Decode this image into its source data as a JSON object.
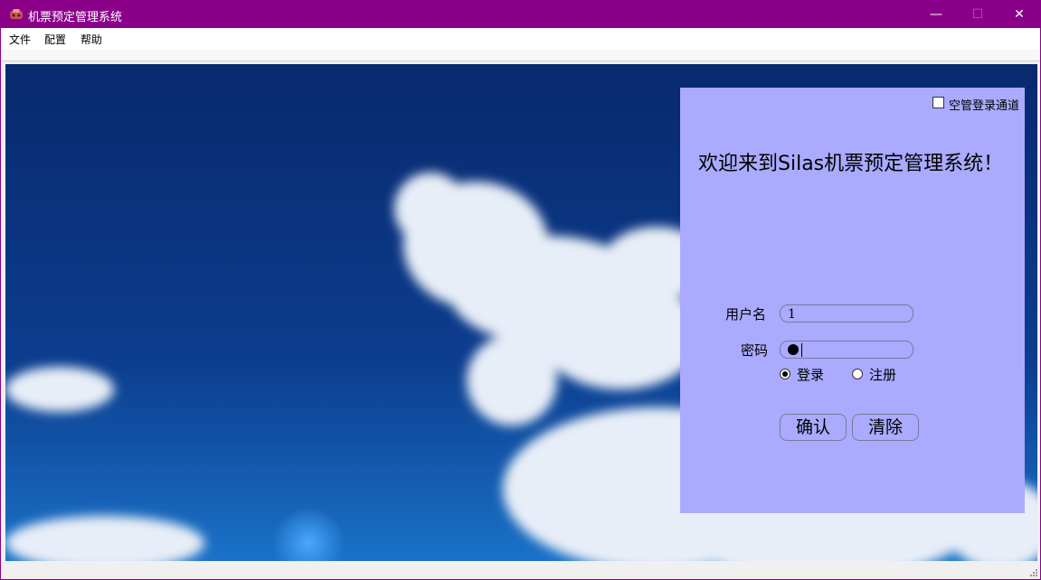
{
  "window": {
    "title": "机票预定管理系统",
    "accent": "#8b0089",
    "controls": {
      "minimize": "—",
      "maximize": "☐",
      "close": "✕"
    }
  },
  "menu": {
    "items": [
      "文件",
      "配置",
      "帮助"
    ]
  },
  "login": {
    "admin_checkbox": {
      "label": "空管登录通道",
      "checked": false
    },
    "welcome": "欢迎来到Silas机票预定管理系统！",
    "username": {
      "label": "用户名",
      "value": "1"
    },
    "password": {
      "label": "密码",
      "masked_chars": 1
    },
    "mode": {
      "options": [
        "登录",
        "注册"
      ],
      "selected": "登录"
    },
    "buttons": {
      "confirm": "确认",
      "clear": "清除"
    },
    "panel_color": "#aaaafe"
  },
  "background": {
    "description_icon": "sky-clouds-image"
  }
}
